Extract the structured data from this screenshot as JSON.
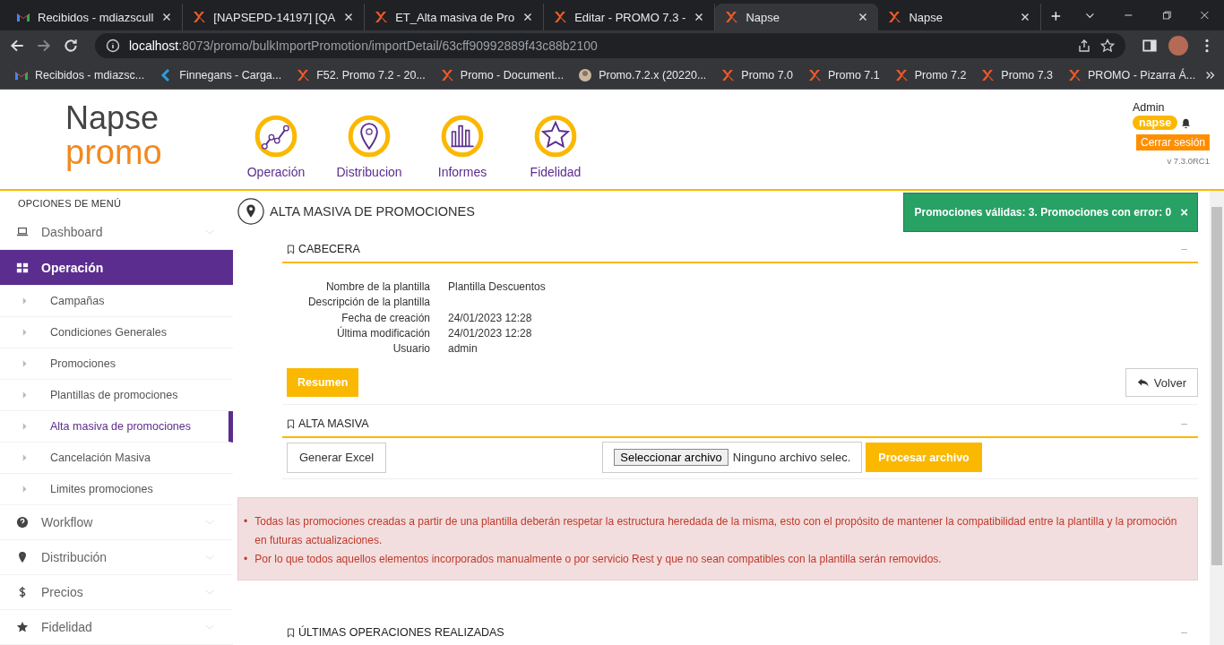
{
  "browser": {
    "tabs": [
      {
        "title": "Recibidos - mdiazscull",
        "selected": false
      },
      {
        "title": "[NAPSEPD-14197] [QA",
        "selected": false
      },
      {
        "title": "ET_Alta masiva de Pro",
        "selected": false
      },
      {
        "title": "Editar - PROMO 7.3 -",
        "selected": false
      },
      {
        "title": "Napse",
        "selected": true
      },
      {
        "title": "Napse",
        "selected": false
      }
    ],
    "url_host": "localhost",
    "url_path": ":8073/promo/bulkImportPromotion/importDetail/63cff90992889f43c88b2100",
    "bookmarks": [
      {
        "title": "Recibidos - mdiazsc..."
      },
      {
        "title": "Finnegans - Carga..."
      },
      {
        "title": "F52. Promo 7.2 - 20..."
      },
      {
        "title": "Promo - Document..."
      },
      {
        "title": "Promo.7.2.x (20220..."
      },
      {
        "title": "Promo 7.0"
      },
      {
        "title": "Promo 7.1"
      },
      {
        "title": "Promo 7.2"
      },
      {
        "title": "Promo 7.3"
      },
      {
        "title": "PROMO - Pizarra Á..."
      }
    ]
  },
  "header": {
    "logo_top": "Napse",
    "logo_bottom": "promo",
    "nav": [
      {
        "label": "Operación"
      },
      {
        "label": "Distribucion"
      },
      {
        "label": "Informes"
      },
      {
        "label": "Fidelidad"
      }
    ],
    "user": "Admin",
    "badge": "napse",
    "logout": "Cerrar sesión",
    "version": "v 7.3.0RC1"
  },
  "sidebar": {
    "title": "OPCIONES DE MENÚ",
    "items": [
      {
        "label": "Dashboard",
        "selected": false
      },
      {
        "label": "Operación",
        "selected": true,
        "children": [
          {
            "label": "Campañas",
            "selected": false
          },
          {
            "label": "Condiciones Generales",
            "selected": false
          },
          {
            "label": "Promociones",
            "selected": false
          },
          {
            "label": "Plantillas de promociones",
            "selected": false
          },
          {
            "label": "Alta masiva de promociones",
            "selected": true
          },
          {
            "label": "Cancelación Masiva",
            "selected": false
          },
          {
            "label": "Limites promociones",
            "selected": false
          }
        ]
      },
      {
        "label": "Workflow",
        "selected": false
      },
      {
        "label": "Distribución",
        "selected": false
      },
      {
        "label": "Precios",
        "selected": false
      },
      {
        "label": "Fidelidad",
        "selected": false
      }
    ]
  },
  "page": {
    "title": "ALTA MASIVA DE PROMOCIONES",
    "toast": {
      "text": "Promociones válidas: 3. Promociones con error: 0",
      "close": "×"
    },
    "header_section": {
      "title": "CABECERA",
      "collapse": "–",
      "fields": [
        {
          "label": "Nombre de la plantilla",
          "value": "Plantilla Descuentos"
        },
        {
          "label": "Descripción de la plantilla"
        },
        {
          "label": "Fecha de creación",
          "value": "24/01/2023 12:28"
        },
        {
          "label": "Última modificación",
          "value": "24/01/2023 12:28"
        },
        {
          "label": "Usuario",
          "value": "admin"
        }
      ],
      "summary_button": "Resumen",
      "back_button": "Volver"
    },
    "bulk_section": {
      "title": "ALTA MASIVA",
      "collapse": "–",
      "excel_button": "Generar Excel",
      "file_button": "Seleccionar archivo",
      "file_name": "Ninguno archivo selec.",
      "process_button": "Procesar archivo"
    },
    "alert": [
      {
        "bullet": "•",
        "text": "Todas las promociones creadas a partir de una plantilla deberán respetar la estructura heredada de la misma, esto con el propósito de mantener la compatibilidad entre la plantilla y la promoción en futuras actualizaciones."
      },
      {
        "bullet": "•",
        "text": "Por lo que todos aquellos elementos incorporados manualmente o por servicio Rest y que no sean compatibles con la plantilla serán removidos."
      }
    ],
    "last_section": {
      "title": "ÚLTIMAS OPERACIONES REALIZADAS",
      "collapse": "–"
    }
  }
}
